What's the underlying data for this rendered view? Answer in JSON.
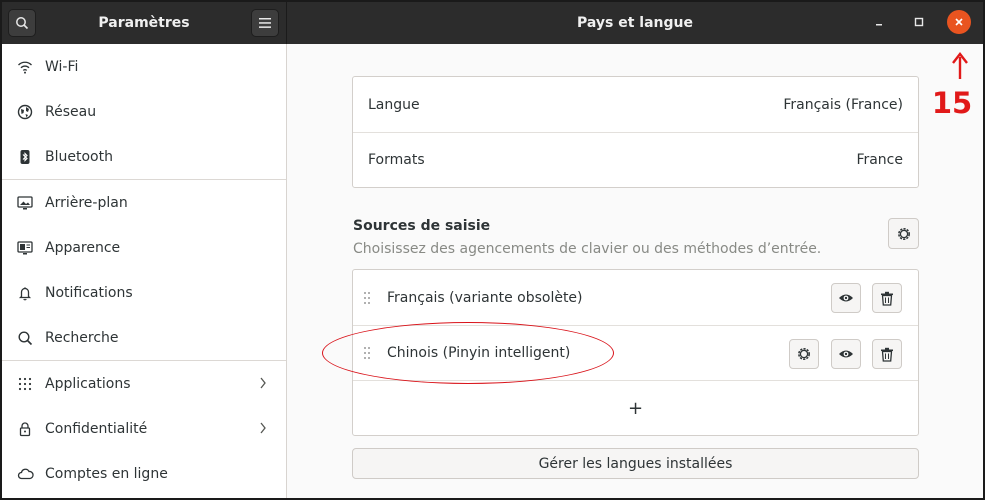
{
  "sidebar": {
    "title": "Paramètres",
    "items": [
      {
        "label": "Wi-Fi",
        "icon": "wifi-icon"
      },
      {
        "label": "Réseau",
        "icon": "network-icon"
      },
      {
        "label": "Bluetooth",
        "icon": "bluetooth-icon"
      },
      {
        "label": "Arrière-plan",
        "icon": "background-icon"
      },
      {
        "label": "Apparence",
        "icon": "appearance-icon"
      },
      {
        "label": "Notifications",
        "icon": "bell-icon"
      },
      {
        "label": "Recherche",
        "icon": "search-icon"
      },
      {
        "label": "Applications",
        "icon": "apps-grid-icon"
      },
      {
        "label": "Confidentialité",
        "icon": "lock-icon"
      },
      {
        "label": "Comptes en ligne",
        "icon": "cloud-icon"
      }
    ]
  },
  "header": {
    "title": "Pays et langue"
  },
  "region": {
    "language_label": "Langue",
    "language_value": "Français (France)",
    "formats_label": "Formats",
    "formats_value": "France"
  },
  "input_sources": {
    "title": "Sources de saisie",
    "subtitle": "Choisissez des agencements de clavier ou des méthodes d’entrée.",
    "items": [
      {
        "label": "Français (variante obsolète)"
      },
      {
        "label": "Chinois (Pinyin intelligent)"
      }
    ],
    "add_symbol": "+"
  },
  "manage_button": "Gérer les langues installées",
  "annotation": {
    "number": "15",
    "color": "#e11919"
  },
  "colors": {
    "headerbar": "#2c2c2c",
    "accent_close": "#e95420"
  }
}
